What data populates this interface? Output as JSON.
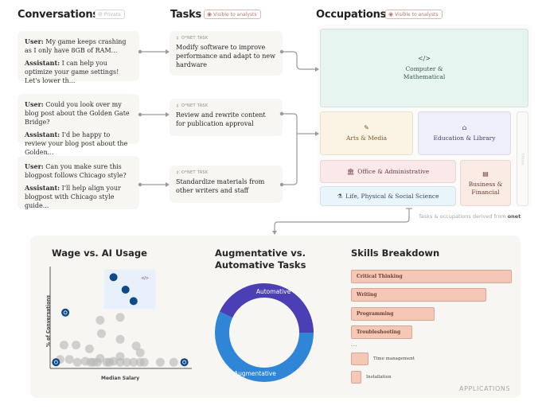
{
  "header": {
    "conversations": {
      "title": "Conversations",
      "badge": "Private",
      "badge_icon": "eye-off-icon"
    },
    "tasks": {
      "title": "Tasks",
      "badge": "Visible to analysts",
      "badge_icon": "eye-icon"
    },
    "occupations": {
      "title": "Occupations",
      "badge": "Visible to analysts",
      "badge_icon": "eye-icon"
    }
  },
  "conversations": [
    {
      "user_label": "User:",
      "user_text": " My game keeps crashing as I only have 8GB of RAM...",
      "assistant_label": "Assistant:",
      "assistant_text": " I can help you optimize your game settings! Let's lower th..."
    },
    {
      "user_label": "User:",
      "user_text": "  Could you look over my blog post about the Golden Gate Bridge?",
      "assistant_label": "Assistant:",
      "assistant_text": " I'd be happy to review your blog post about the Golden..."
    },
    {
      "user_label": "User:",
      "user_text": " Can you make sure this blogpost follows Chicago style?",
      "assistant_label": "Assistant:",
      "assistant_text": " I'll help align your blogpost with Chicago style guide..."
    }
  ],
  "tasks": [
    {
      "tag": "O*NET TASK",
      "text": "Modify software to improve performance and adapt to new hardware"
    },
    {
      "tag": "O*NET TASK",
      "text": "Review and rewrite content for publication approval"
    },
    {
      "tag": "O*NET TASK",
      "text": "Standardize materials from other writers and staff"
    }
  ],
  "occupations": [
    {
      "label": "Computer & Mathematical",
      "icon": "</>",
      "icon_name": "code-icon",
      "color": "#e6f5ef",
      "text_color": "#3a5a4f"
    },
    {
      "label": "Arts & Media",
      "icon": "✎",
      "icon_name": "brush-icon",
      "color": "#fbf3e4",
      "text_color": "#7a5a2a"
    },
    {
      "label": "Education & Library",
      "icon": "🎓",
      "icon_name": "graduation-cap-icon",
      "color": "#eeeffa",
      "text_color": "#3e3f6a"
    },
    {
      "label": "Office & Administrative",
      "icon": "🏛",
      "icon_name": "building-icon",
      "color": "#fbe9ea",
      "text_color": "#6a3a3f"
    },
    {
      "label": "Life, Physical & Social Science",
      "icon": "⚗",
      "icon_name": "flask-icon",
      "color": "#e9f4fb",
      "text_color": "#2e4a62"
    },
    {
      "label": "Business & Financial",
      "icon": "▤",
      "icon_name": "ledger-icon",
      "color": "#fbebe5",
      "text_color": "#6a3a2e"
    },
    {
      "label": "Other",
      "icon": "",
      "icon_name": "",
      "color": "#fafaf8",
      "text_color": "#d0d0d0"
    }
  ],
  "footnote": {
    "prefix": "Tasks & occupations derived from ",
    "brand": "onet"
  },
  "applications": {
    "label": "APPLICATIONS",
    "wage": {
      "title": "Wage vs. AI Usage",
      "xlabel": "Median Salary",
      "ylabel": "% of Conversations",
      "highlight_icon": "</>"
    },
    "donut": {
      "title_line1": "Augmentative vs.",
      "title_line2": "Automative Tasks"
    },
    "skills": {
      "title": "Skills Breakdown",
      "ellipsis": "..."
    }
  },
  "chart_data": [
    {
      "type": "scatter",
      "title": "Wage vs. AI Usage",
      "xlabel": "Median Salary",
      "ylabel": "% of Conversations",
      "xlim": [
        0,
        100
      ],
      "ylim": [
        0,
        100
      ],
      "grid": false,
      "highlighted_series": [
        {
          "name": "Computer & Mathematical",
          "color": "#0e4a8a",
          "points": [
            [
              45,
              93
            ],
            [
              54,
              80
            ],
            [
              60,
              68
            ]
          ]
        },
        {
          "name": "Education & Library",
          "color": "#0e4a8a",
          "points": [
            [
              9,
              56
            ]
          ],
          "icon": "graduation-cap-icon"
        },
        {
          "name": "Office & Administrative",
          "color": "#0e4a8a",
          "points": [
            [
              2,
              4
            ]
          ],
          "icon": "building-icon"
        },
        {
          "name": "Business & Financial",
          "color": "#0e4a8a",
          "points": [
            [
              98,
              4
            ]
          ],
          "icon": "ledger-icon"
        }
      ],
      "background_points": {
        "color": "#b5b5b5",
        "points": [
          [
            35,
            48
          ],
          [
            50,
            51
          ],
          [
            50,
            28
          ],
          [
            36,
            34
          ],
          [
            8,
            22
          ],
          [
            17,
            22
          ],
          [
            27,
            18
          ],
          [
            62,
            21
          ],
          [
            65,
            14
          ],
          [
            50,
            10
          ],
          [
            5,
            7
          ],
          [
            12,
            7
          ],
          [
            18,
            4
          ],
          [
            24,
            5
          ],
          [
            30,
            4
          ],
          [
            35,
            8
          ],
          [
            40,
            4
          ],
          [
            45,
            5
          ],
          [
            50,
            4
          ],
          [
            55,
            4
          ],
          [
            60,
            4
          ],
          [
            65,
            4
          ],
          [
            68,
            4
          ],
          [
            80,
            4
          ],
          [
            90,
            4
          ],
          [
            28,
            4
          ],
          [
            33,
            4
          ],
          [
            42,
            4
          ]
        ]
      }
    },
    {
      "type": "pie",
      "title": "Augmentative vs. Automative Tasks",
      "donut": true,
      "slices": [
        {
          "label": "Automative",
          "value": 43,
          "color": "#4a3fb5"
        },
        {
          "label": "Augmentative",
          "value": 57,
          "color": "#2f86d6"
        }
      ]
    },
    {
      "type": "bar",
      "title": "Skills Breakdown",
      "orientation": "horizontal",
      "categories": [
        "Critical Thinking",
        "Writing",
        "Programming",
        "Troubleshooting",
        "Time management",
        "Installation"
      ],
      "values": [
        100,
        84,
        52,
        38,
        6,
        3
      ],
      "color": "#f5c7b7"
    }
  ]
}
